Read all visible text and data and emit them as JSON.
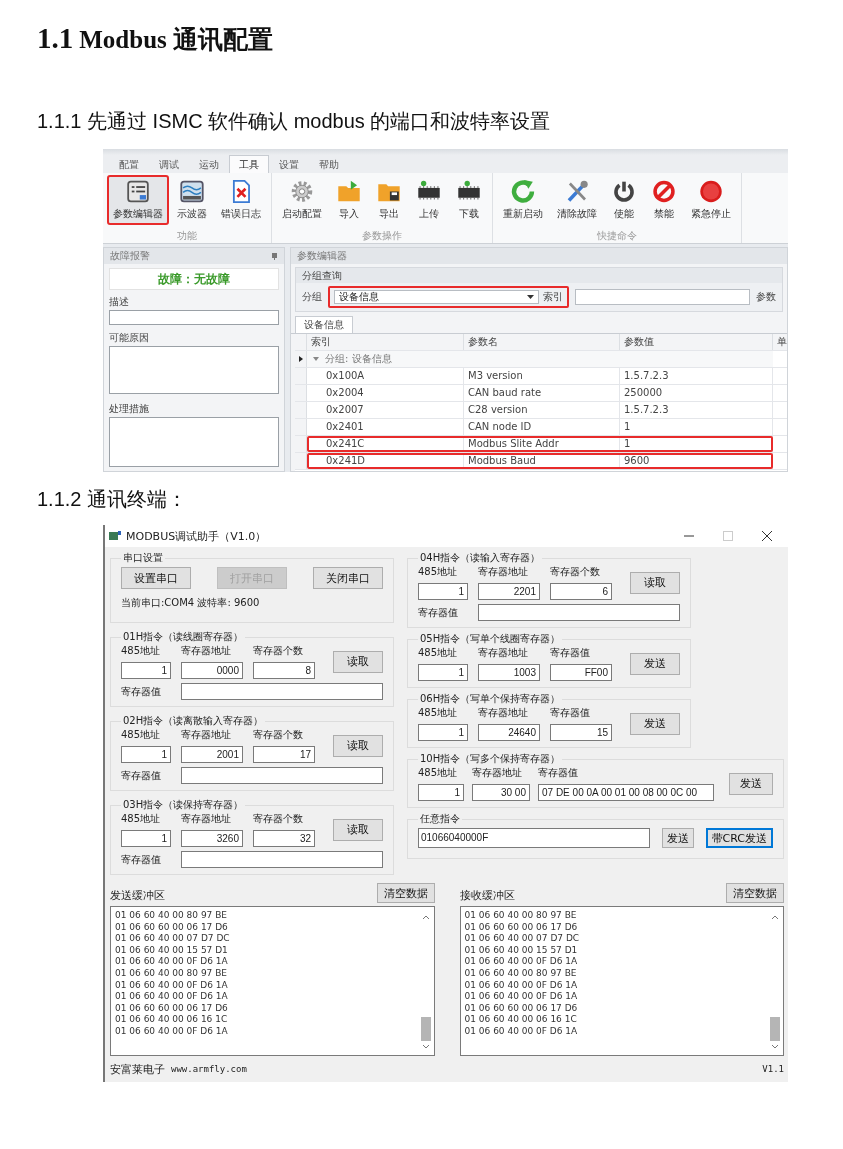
{
  "heading": {
    "number": "1.1",
    "title": "Modbus 通讯配置"
  },
  "step1": "1.1.1 先通过 ISMC 软件确认 modbus 的端口和波特率设置",
  "ismc": {
    "tabs": [
      {
        "label": "配置",
        "selected": false
      },
      {
        "label": "调试",
        "selected": false
      },
      {
        "label": "运动",
        "selected": false
      },
      {
        "label": "工具",
        "selected": true
      },
      {
        "label": "设置",
        "selected": false
      },
      {
        "label": "帮助",
        "selected": false
      }
    ],
    "ribbon_groups": [
      {
        "label": "功能",
        "buttons": [
          {
            "label": "参数编辑器",
            "highlighted": true
          },
          {
            "label": "示波器",
            "highlighted": false
          },
          {
            "label": "错误日志",
            "highlighted": false
          }
        ]
      },
      {
        "label": "参数操作",
        "buttons": [
          {
            "label": "启动配置",
            "highlighted": false
          },
          {
            "label": "导入",
            "highlighted": false
          },
          {
            "label": "导出",
            "highlighted": false
          },
          {
            "label": "上传",
            "highlighted": false
          },
          {
            "label": "下载",
            "highlighted": false
          }
        ]
      },
      {
        "label": "快捷命令",
        "buttons": [
          {
            "label": "重新启动",
            "highlighted": false
          },
          {
            "label": "清除故障",
            "highlighted": false
          },
          {
            "label": "使能",
            "highlighted": false
          },
          {
            "label": "禁能",
            "highlighted": false
          },
          {
            "label": "紧急停止",
            "highlighted": false
          }
        ]
      }
    ],
    "fault_panel": {
      "title": "故障报警",
      "status": "故障：无故障",
      "fields": [
        {
          "label": "描述",
          "kind": "line"
        },
        {
          "label": "可能原因",
          "kind": "area"
        },
        {
          "label": "处理措施",
          "kind": "area"
        }
      ]
    },
    "editor": {
      "title": "参数编辑器",
      "query": {
        "title": "分组查询",
        "group_label": "分组",
        "group_value": "设备信息",
        "highlighted": true,
        "index_label": "索引",
        "param_label": "参数"
      },
      "tabs": [
        {
          "label": "设备信息",
          "selected": true
        }
      ],
      "columns": [
        "索引",
        "参数名",
        "参数值",
        "单"
      ],
      "group_row": {
        "label": "分组: 设备信息",
        "expanded": true
      },
      "rows": [
        {
          "index": "0x100A",
          "name": "M3 version",
          "value": "1.5.7.2.3",
          "highlighted": false
        },
        {
          "index": "0x2004",
          "name": "CAN baud rate",
          "value": "250000",
          "highlighted": false
        },
        {
          "index": "0x2007",
          "name": "C28 version",
          "value": "1.5.7.2.3",
          "highlighted": false
        },
        {
          "index": "0x2401",
          "name": "CAN node ID",
          "value": "1",
          "highlighted": false
        },
        {
          "index": "0x241C",
          "name": "Modbus Slite Addr",
          "value": "1",
          "highlighted": true
        },
        {
          "index": "0x241D",
          "name": "Modbus Baud",
          "value": "9600",
          "highlighted": true
        }
      ]
    }
  },
  "step2": "1.1.2 通讯终端：",
  "modbus": {
    "title": "MODBUS调试助手（V1.0）",
    "left": {
      "serial": {
        "title": "串口设置",
        "buttons": [
          {
            "label": "设置串口",
            "disabled": false
          },
          {
            "label": "打开串口",
            "disabled": true
          },
          {
            "label": "关闭串口",
            "disabled": false
          }
        ],
        "status": "当前串口:COM4 波特率: 9600"
      },
      "commands": [
        {
          "kind": "read",
          "title": "01H指令（读线圈寄存器）",
          "fields": [
            {
              "label": "485地址",
              "value": "1"
            },
            {
              "label": "寄存器地址",
              "value": "0000"
            },
            {
              "label": "寄存器个数",
              "value": "8"
            }
          ],
          "button": "读取",
          "result_label": "寄存器值"
        },
        {
          "kind": "read",
          "title": "02H指令（读离散输入寄存器）",
          "fields": [
            {
              "label": "485地址",
              "value": "1"
            },
            {
              "label": "寄存器地址",
              "value": "2001"
            },
            {
              "label": "寄存器个数",
              "value": "17"
            }
          ],
          "button": "读取",
          "result_label": "寄存器值"
        },
        {
          "kind": "read",
          "title": "03H指令（读保持寄存器）",
          "fields": [
            {
              "label": "485地址",
              "value": "1"
            },
            {
              "label": "寄存器地址",
              "value": "3260"
            },
            {
              "label": "寄存器个数",
              "value": "32"
            }
          ],
          "button": "读取",
          "result_label": "寄存器值"
        }
      ]
    },
    "right": {
      "commands": [
        {
          "kind": "read",
          "title": "04H指令（读输入寄存器）",
          "fields": [
            {
              "label": "485地址",
              "value": "1"
            },
            {
              "label": "寄存器地址",
              "value": "2201"
            },
            {
              "label": "寄存器个数",
              "value": "6"
            }
          ],
          "button": "读取",
          "result_label": "寄存器值"
        },
        {
          "kind": "write",
          "title": "05H指令（写单个线圈寄存器）",
          "fields": [
            {
              "label": "485地址",
              "value": "1"
            },
            {
              "label": "寄存器地址",
              "value": "1003"
            },
            {
              "label": "寄存器值",
              "value": "FF00"
            }
          ],
          "button": "发送"
        },
        {
          "kind": "write",
          "title": "06H指令（写单个保持寄存器）",
          "fields": [
            {
              "label": "485地址",
              "value": "1"
            },
            {
              "label": "寄存器地址",
              "value": "24640"
            },
            {
              "label": "寄存器值",
              "value": "15"
            }
          ],
          "button": "发送"
        },
        {
          "kind": "write_multi",
          "title": "10H指令（写多个保持寄存器）",
          "fields": [
            {
              "label": "485地址",
              "value": "1"
            },
            {
              "label": "寄存器地址",
              "value": "30 00"
            },
            {
              "label": "寄存器值",
              "value": "07 DE  00 0A  00 01  00 08  00 0C  00"
            }
          ],
          "button": "发送"
        }
      ],
      "custom": {
        "title": "任意指令",
        "value": "01066040000F",
        "buttons": [
          {
            "label": "发送",
            "focused": false
          },
          {
            "label": "带CRC发送",
            "focused": true
          }
        ]
      }
    },
    "buffers": [
      {
        "title": "发送缓冲区",
        "button": "清空数据",
        "lines": [
          "01 06 60 40 00 80 97 BE",
          "01 06 60 60 00 06 17 D6",
          "01 06 60 40 00 07 D7 DC",
          "01 06 60 40 00 15 57 D1",
          "01 06 60 40 00 0F D6 1A",
          "01 06 60 40 00 80 97 BE",
          "01 06 60 40 00 0F D6 1A",
          "01 06 60 40 00 0F D6 1A",
          "01 06 60 60 00 06 17 D6",
          "01 06 60 40 00 06 16 1C",
          "01 06 60 40 00 0F D6 1A"
        ]
      },
      {
        "title": "接收缓冲区",
        "button": "清空数据",
        "lines": [
          "01 06 60 40 00 80 97 BE",
          "01 06 60 60 00 06 17 D6",
          "01 06 60 40 00 07 D7 DC",
          "01 06 60 40 00 15 57 D1",
          "01 06 60 40 00 0F D6 1A",
          "01 06 60 40 00 80 97 BE",
          "01 06 60 40 00 0F D6 1A",
          "01 06 60 40 00 0F D6 1A",
          "01 06 60 60 00 06 17 D6",
          "01 06 60 40 00 06 16 1C",
          "01 06 60 40 00 0F D6 1A"
        ]
      }
    ],
    "footer": {
      "company": "安富莱电子",
      "url": "www.armfly.com",
      "version": "V1.1"
    }
  }
}
